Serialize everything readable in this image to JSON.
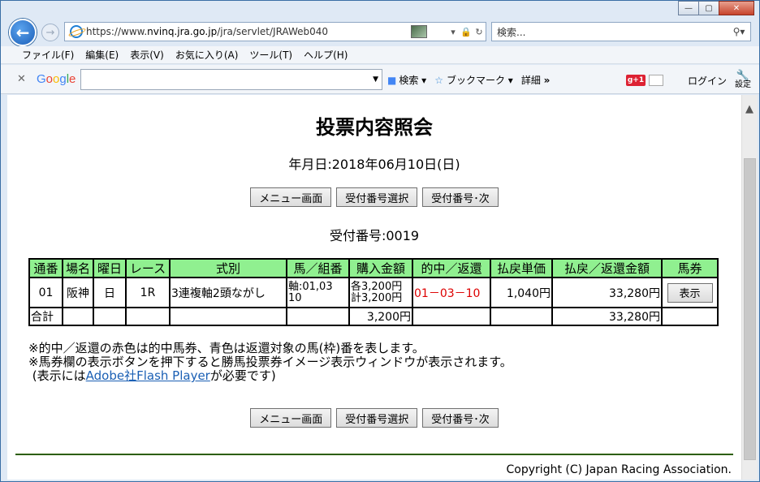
{
  "browser": {
    "url_prefix": "https://www.",
    "url_host": "nvinq.jra.go.jp",
    "url_path": "/jra/servlet/JRAWeb040",
    "search_placeholder": "検索...",
    "menu": [
      "ファイル(F)",
      "編集(E)",
      "表示(V)",
      "お気に入り(A)",
      "ツール(T)",
      "ヘルプ(H)"
    ],
    "google": {
      "logo": "Google",
      "search_label": "検索",
      "bookmark_label": "ブックマーク",
      "details_label": "詳細",
      "more": "»",
      "gplus": "g+1",
      "login_label": "ログイン",
      "settings_label": "設定"
    },
    "window_buttons": {
      "minimize": "—",
      "maximize": "▢",
      "close": "✕"
    }
  },
  "page": {
    "title": "投票内容照会",
    "date_line": "年月日:2018年06月10日(日)",
    "buttons": {
      "menu": "メニュー画面",
      "select": "受付番号選択",
      "next": "受付番号･次"
    },
    "receipt_line": "受付番号:0019",
    "table": {
      "headers": [
        "通番",
        "場名",
        "曜日",
        "レース",
        "式別",
        "馬／組番",
        "購入金額",
        "的中／返還",
        "払戻単価",
        "払戻／返還金額",
        "馬券"
      ],
      "row": {
        "no": "01",
        "venue": "阪神",
        "day": "日",
        "race": "1R",
        "type": "3連複軸2頭ながし",
        "combo_line1": "軸:01,03",
        "combo_line2": "10",
        "amount_line1": "各3,200円",
        "amount_line2": "計3,200円",
        "hit": "01－03－10",
        "unit_price": "1,040円",
        "payout": "33,280円",
        "ticket_button": "表示"
      },
      "total": {
        "label": "合計",
        "amount": "3,200円",
        "payout": "33,280円"
      }
    },
    "notes": {
      "line1": "※的中／返還の赤色は的中馬券、青色は返還対象の馬(枠)番を表します。",
      "line2": "※馬券欄の表示ボタンを押下すると勝馬投票券イメージ表示ウィンドウが表示されます。",
      "line3_pre": "(表示には",
      "line3_link": "Adobe社Flash Player",
      "line3_post": "が必要です)"
    },
    "copyright": "Copyright (C) Japan Racing Association."
  }
}
